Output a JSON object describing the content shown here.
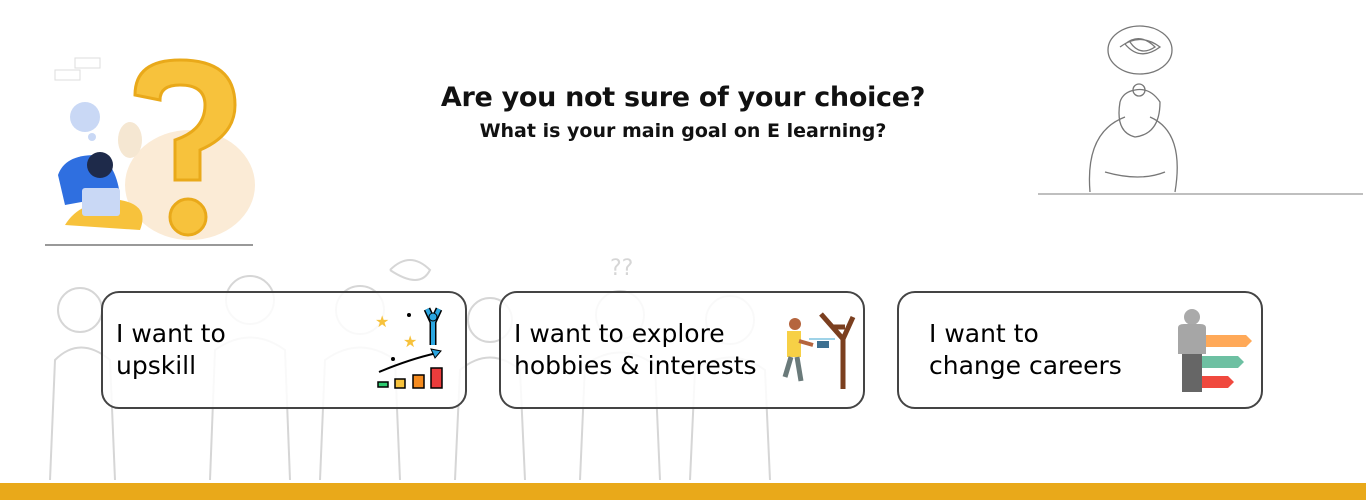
{
  "header": {
    "title": "Are you not sure of your choice?",
    "subtitle": "What is your main goal on E learning?"
  },
  "options": [
    {
      "label_line1": "I want to",
      "label_line2": "upskill",
      "icon": "growth-chart-icon"
    },
    {
      "label_line1": "I want to explore",
      "label_line2": "hobbies & interests",
      "icon": "drone-hobby-icon"
    },
    {
      "label_line1": "I want to",
      "label_line2": "change careers",
      "icon": "career-signpost-icon"
    }
  ],
  "colors": {
    "accent": "#E9A91A",
    "question_mark": "#F7C23C",
    "card_border": "#444444"
  }
}
